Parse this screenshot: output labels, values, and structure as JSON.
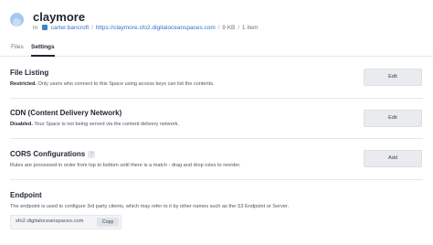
{
  "header": {
    "space_name": "claymore",
    "in_label": "in",
    "project": "carter.bancroft",
    "separator": "/",
    "url": "https://claymore.sfo2.digitaloceanspaces.com",
    "size": "9 KB",
    "item_count": "1 item"
  },
  "tabs": [
    {
      "label": "Files",
      "active": false
    },
    {
      "label": "Settings",
      "active": true
    }
  ],
  "sections": {
    "file_listing": {
      "title": "File Listing",
      "status": "Restricted.",
      "description": " Only users who connect to this Space using access keys can list the contents.",
      "button": "Edit"
    },
    "cdn": {
      "title": "CDN (Content Delivery Network)",
      "status": "Disabled.",
      "description": " Your Space is not being served via the content delivery network.",
      "button": "Edit"
    },
    "cors": {
      "title": "CORS Configurations",
      "help": "?",
      "description": "Rules are processed in order from top to bottom until there is a match - drag and drop rules to reorder.",
      "button": "Add"
    },
    "endpoint": {
      "title": "Endpoint",
      "description": "The endpoint is used to configure 3rd party clients, which may refer to it by other names such as the S3 Endpoint or Server.",
      "value": "sfo2.digitaloceanspaces.com",
      "copy_label": "Copy"
    }
  },
  "colors": {
    "accent_link": "#2f73d1",
    "button_bg": "#e9ebee",
    "text_primary": "#1f2430"
  },
  "icons": {
    "space": "space-avatar-icon",
    "project": "project-icon",
    "help": "help-icon"
  }
}
